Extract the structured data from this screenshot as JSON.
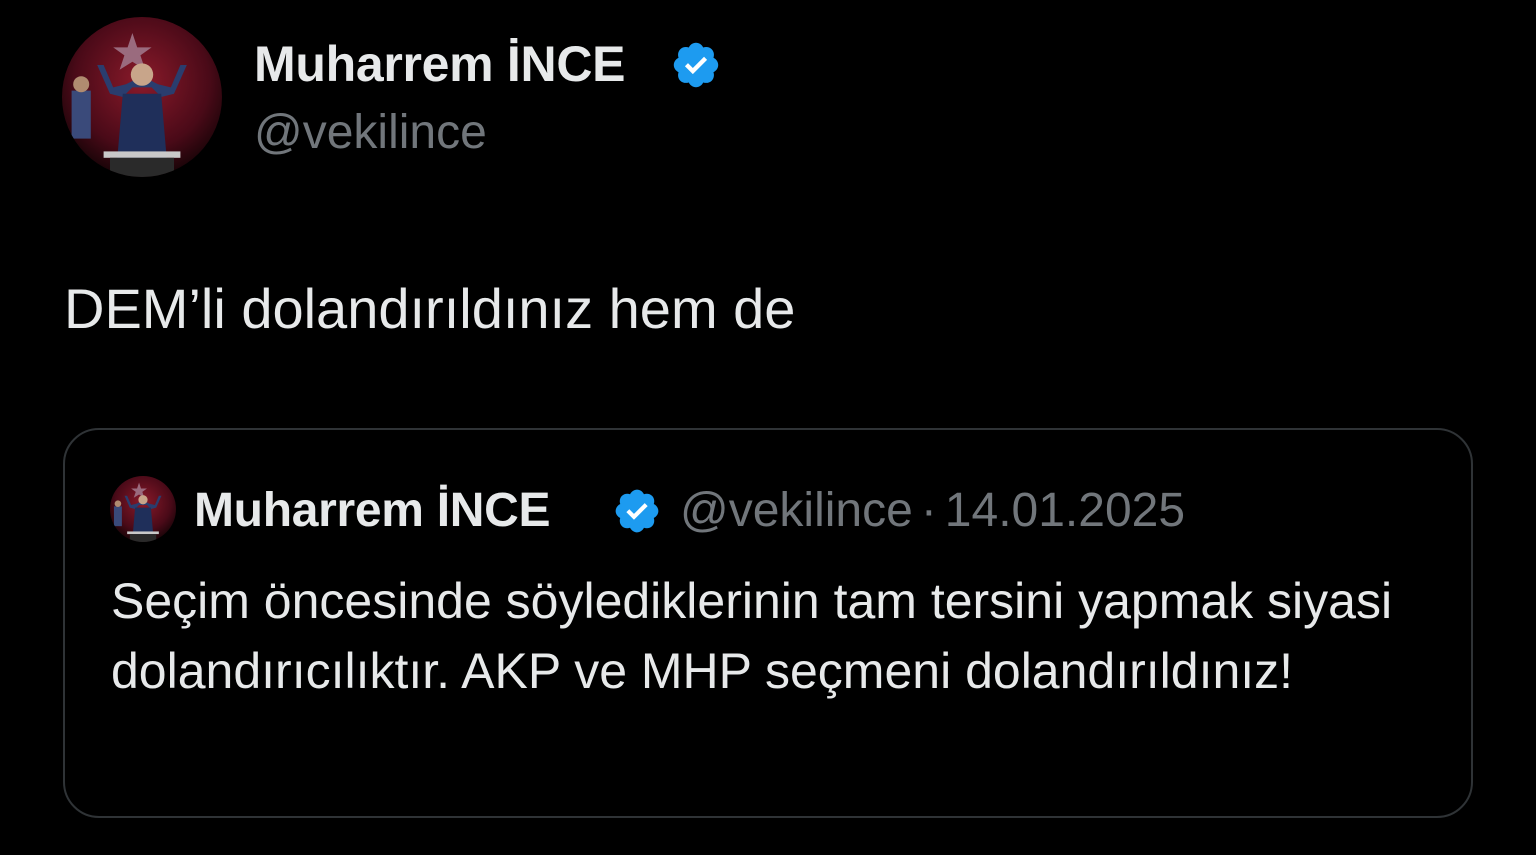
{
  "tweet": {
    "author": {
      "name": "Muharrem İNCE",
      "handle": "@vekilince",
      "verified": true,
      "avatar": "avatar-photo"
    },
    "text": "DEM’li dolandırıldınız hem de",
    "quote": {
      "author": {
        "name": "Muharrem İNCE",
        "handle": "@vekilince",
        "verified": true,
        "avatar": "avatar-photo"
      },
      "separator": "·",
      "date": "14.01.2025",
      "text": "Seçim öncesinde söylediklerinin tam tersini yapmak siyasi dolandırıcılıktır. AKP ve MHP seçmeni dolandırıldınız!"
    }
  },
  "colors": {
    "background": "#000000",
    "text_primary": "#e7e9ea",
    "text_secondary": "#71767b",
    "border": "#2f3336",
    "verified_badge": "#1d9bf0"
  },
  "icons": {
    "verified": "verified-badge-icon",
    "avatar": "avatar-photo"
  }
}
